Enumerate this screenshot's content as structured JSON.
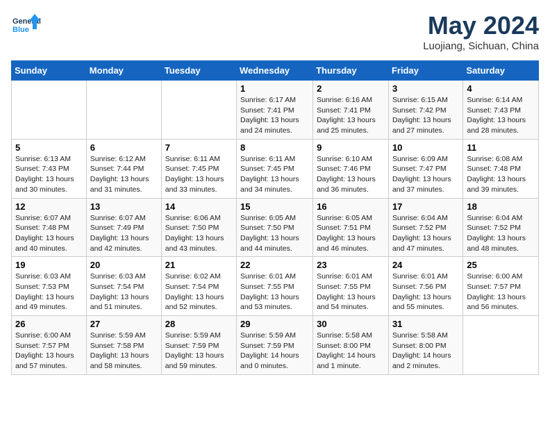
{
  "header": {
    "logo_general": "General",
    "logo_blue": "Blue",
    "month_title": "May 2024",
    "location": "Luojiang, Sichuan, China"
  },
  "days_of_week": [
    "Sunday",
    "Monday",
    "Tuesday",
    "Wednesday",
    "Thursday",
    "Friday",
    "Saturday"
  ],
  "weeks": [
    [
      {
        "day": "",
        "info": ""
      },
      {
        "day": "",
        "info": ""
      },
      {
        "day": "",
        "info": ""
      },
      {
        "day": "1",
        "info": "Sunrise: 6:17 AM\nSunset: 7:41 PM\nDaylight: 13 hours\nand 24 minutes."
      },
      {
        "day": "2",
        "info": "Sunrise: 6:16 AM\nSunset: 7:41 PM\nDaylight: 13 hours\nand 25 minutes."
      },
      {
        "day": "3",
        "info": "Sunrise: 6:15 AM\nSunset: 7:42 PM\nDaylight: 13 hours\nand 27 minutes."
      },
      {
        "day": "4",
        "info": "Sunrise: 6:14 AM\nSunset: 7:43 PM\nDaylight: 13 hours\nand 28 minutes."
      }
    ],
    [
      {
        "day": "5",
        "info": "Sunrise: 6:13 AM\nSunset: 7:43 PM\nDaylight: 13 hours\nand 30 minutes."
      },
      {
        "day": "6",
        "info": "Sunrise: 6:12 AM\nSunset: 7:44 PM\nDaylight: 13 hours\nand 31 minutes."
      },
      {
        "day": "7",
        "info": "Sunrise: 6:11 AM\nSunset: 7:45 PM\nDaylight: 13 hours\nand 33 minutes."
      },
      {
        "day": "8",
        "info": "Sunrise: 6:11 AM\nSunset: 7:45 PM\nDaylight: 13 hours\nand 34 minutes."
      },
      {
        "day": "9",
        "info": "Sunrise: 6:10 AM\nSunset: 7:46 PM\nDaylight: 13 hours\nand 36 minutes."
      },
      {
        "day": "10",
        "info": "Sunrise: 6:09 AM\nSunset: 7:47 PM\nDaylight: 13 hours\nand 37 minutes."
      },
      {
        "day": "11",
        "info": "Sunrise: 6:08 AM\nSunset: 7:48 PM\nDaylight: 13 hours\nand 39 minutes."
      }
    ],
    [
      {
        "day": "12",
        "info": "Sunrise: 6:07 AM\nSunset: 7:48 PM\nDaylight: 13 hours\nand 40 minutes."
      },
      {
        "day": "13",
        "info": "Sunrise: 6:07 AM\nSunset: 7:49 PM\nDaylight: 13 hours\nand 42 minutes."
      },
      {
        "day": "14",
        "info": "Sunrise: 6:06 AM\nSunset: 7:50 PM\nDaylight: 13 hours\nand 43 minutes."
      },
      {
        "day": "15",
        "info": "Sunrise: 6:05 AM\nSunset: 7:50 PM\nDaylight: 13 hours\nand 44 minutes."
      },
      {
        "day": "16",
        "info": "Sunrise: 6:05 AM\nSunset: 7:51 PM\nDaylight: 13 hours\nand 46 minutes."
      },
      {
        "day": "17",
        "info": "Sunrise: 6:04 AM\nSunset: 7:52 PM\nDaylight: 13 hours\nand 47 minutes."
      },
      {
        "day": "18",
        "info": "Sunrise: 6:04 AM\nSunset: 7:52 PM\nDaylight: 13 hours\nand 48 minutes."
      }
    ],
    [
      {
        "day": "19",
        "info": "Sunrise: 6:03 AM\nSunset: 7:53 PM\nDaylight: 13 hours\nand 49 minutes."
      },
      {
        "day": "20",
        "info": "Sunrise: 6:03 AM\nSunset: 7:54 PM\nDaylight: 13 hours\nand 51 minutes."
      },
      {
        "day": "21",
        "info": "Sunrise: 6:02 AM\nSunset: 7:54 PM\nDaylight: 13 hours\nand 52 minutes."
      },
      {
        "day": "22",
        "info": "Sunrise: 6:01 AM\nSunset: 7:55 PM\nDaylight: 13 hours\nand 53 minutes."
      },
      {
        "day": "23",
        "info": "Sunrise: 6:01 AM\nSunset: 7:55 PM\nDaylight: 13 hours\nand 54 minutes."
      },
      {
        "day": "24",
        "info": "Sunrise: 6:01 AM\nSunset: 7:56 PM\nDaylight: 13 hours\nand 55 minutes."
      },
      {
        "day": "25",
        "info": "Sunrise: 6:00 AM\nSunset: 7:57 PM\nDaylight: 13 hours\nand 56 minutes."
      }
    ],
    [
      {
        "day": "26",
        "info": "Sunrise: 6:00 AM\nSunset: 7:57 PM\nDaylight: 13 hours\nand 57 minutes."
      },
      {
        "day": "27",
        "info": "Sunrise: 5:59 AM\nSunset: 7:58 PM\nDaylight: 13 hours\nand 58 minutes."
      },
      {
        "day": "28",
        "info": "Sunrise: 5:59 AM\nSunset: 7:59 PM\nDaylight: 13 hours\nand 59 minutes."
      },
      {
        "day": "29",
        "info": "Sunrise: 5:59 AM\nSunset: 7:59 PM\nDaylight: 14 hours\nand 0 minutes."
      },
      {
        "day": "30",
        "info": "Sunrise: 5:58 AM\nSunset: 8:00 PM\nDaylight: 14 hours\nand 1 minute."
      },
      {
        "day": "31",
        "info": "Sunrise: 5:58 AM\nSunset: 8:00 PM\nDaylight: 14 hours\nand 2 minutes."
      },
      {
        "day": "",
        "info": ""
      }
    ]
  ]
}
